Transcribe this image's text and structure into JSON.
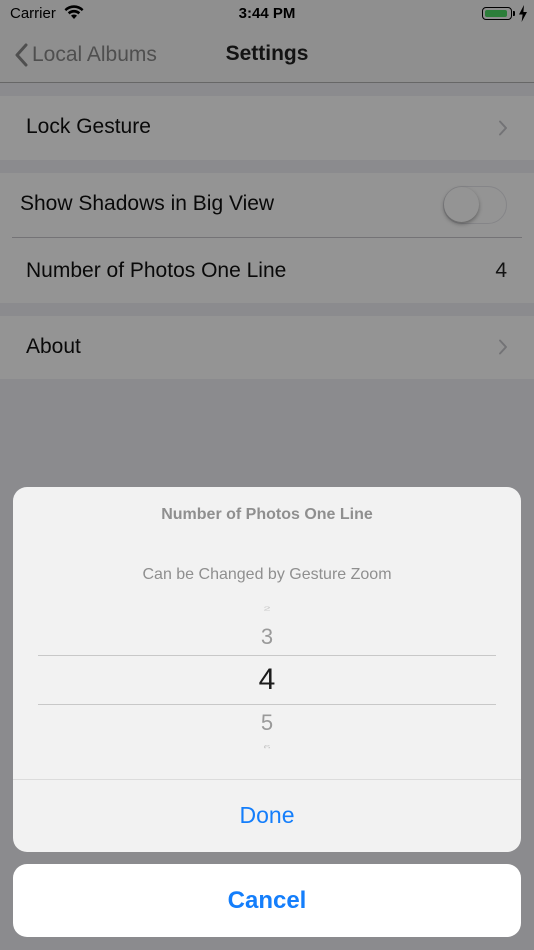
{
  "status_bar": {
    "carrier": "Carrier",
    "time": "3:44 PM"
  },
  "nav": {
    "back_label": "Local Albums",
    "title": "Settings"
  },
  "settings": {
    "lock_gesture": "Lock Gesture",
    "show_shadows": "Show Shadows in Big View",
    "show_shadows_on": false,
    "photos_per_line_label": "Number of Photos One Line",
    "photos_per_line_value": "4",
    "about": "About"
  },
  "sheet": {
    "title": "Number of Photos One Line",
    "message": "Can be Changed by Gesture Zoom",
    "picker_values": {
      "above2": "2",
      "above1": "3",
      "selected": "4",
      "below1": "5",
      "below2": "6"
    },
    "done_label": "Done",
    "cancel_label": "Cancel"
  },
  "colors": {
    "accent": "#147efb",
    "battery": "#4cd964"
  }
}
